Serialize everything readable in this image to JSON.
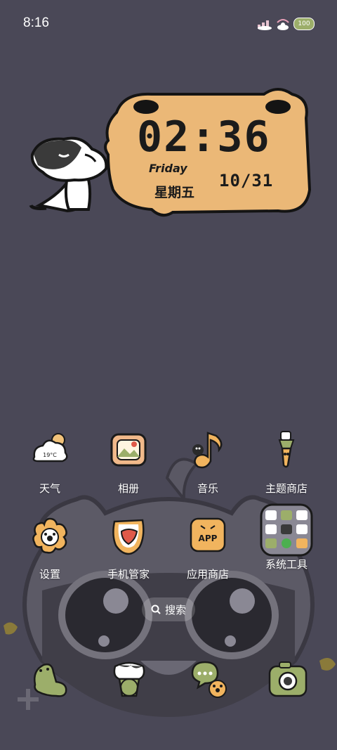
{
  "status_bar": {
    "time": "8:16",
    "battery": "100"
  },
  "clock_widget": {
    "time": "02:36",
    "day_en": "Friday",
    "day_cn": "星期五",
    "date": "10/31",
    "bubble_color": "#ebb877"
  },
  "apps": [
    {
      "label": "天气",
      "icon": "weather-icon",
      "temp": "19°C"
    },
    {
      "label": "相册",
      "icon": "gallery-icon"
    },
    {
      "label": "音乐",
      "icon": "music-icon"
    },
    {
      "label": "主题商店",
      "icon": "theme-store-icon"
    },
    {
      "label": "设置",
      "icon": "settings-icon"
    },
    {
      "label": "手机管家",
      "icon": "phone-manager-icon"
    },
    {
      "label": "应用商店",
      "icon": "app-store-icon",
      "badge_text": "APP"
    },
    {
      "label": "系统工具",
      "icon": "system-tools-folder-icon"
    }
  ],
  "search": {
    "label": "搜索"
  },
  "dock": [
    {
      "icon": "phone-icon"
    },
    {
      "icon": "browser-icon"
    },
    {
      "icon": "messages-icon"
    },
    {
      "icon": "camera-icon"
    }
  ]
}
